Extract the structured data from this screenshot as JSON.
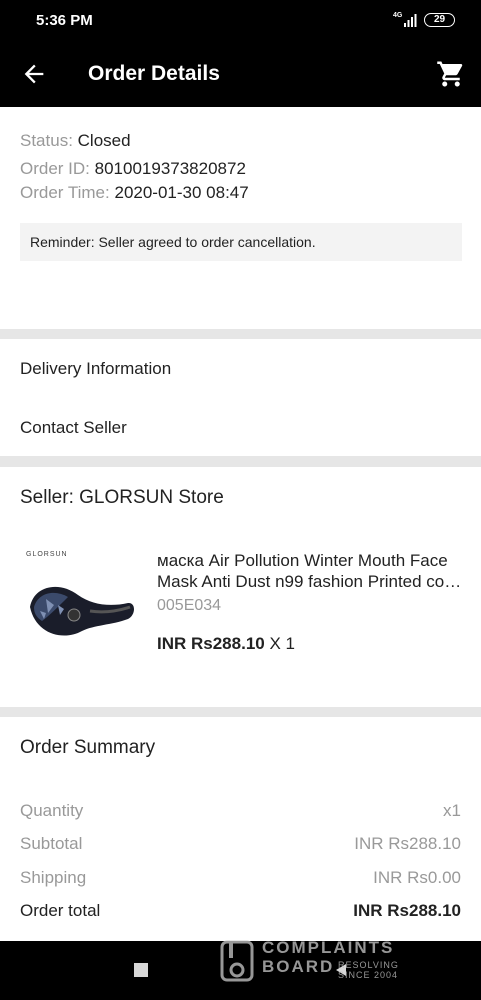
{
  "status_bar": {
    "time": "5:36 PM",
    "network": "4G",
    "battery": "29"
  },
  "header": {
    "title": "Order Details",
    "back_icon": "arrow-left-icon",
    "cart_icon": "shopping-cart-icon"
  },
  "order": {
    "status_label": "Status:",
    "status_value": "Closed",
    "id_label": "Order ID:",
    "id_value": "8010019373820872",
    "time_label": "Order Time:",
    "time_value": "2020-01-30 08:47",
    "reminder": "Reminder: Seller agreed to order cancellation."
  },
  "links": {
    "delivery": "Delivery Information",
    "contact": "Contact Seller"
  },
  "seller": {
    "name": "Seller: GLORSUN Store",
    "brand": "GLORSUN",
    "product_line1": "маска Air Pollution Winter Mouth Face",
    "product_line2": "Mask Anti Dust n99 fashion Printed cotton ...",
    "sku": "005E034",
    "price": "INR Rs288.10",
    "qty": "X 1"
  },
  "summary": {
    "title": "Order Summary",
    "rows": [
      {
        "label": "Quantity",
        "value": "x1"
      },
      {
        "label": "Subtotal",
        "value": "INR Rs288.10"
      },
      {
        "label": "Shipping",
        "value": "INR Rs0.00"
      },
      {
        "label": "Order total",
        "value": "INR Rs288.10"
      }
    ]
  },
  "watermark": {
    "line1": "COMPLAINTS",
    "line2": "BOARD",
    "line3": "RESOLVING",
    "line4": "SINCE 2004"
  },
  "colors": {
    "bar_bg": "#000000",
    "muted_text": "#999999",
    "primary_text": "#222222",
    "reminder_bg": "#f3f3f3"
  }
}
